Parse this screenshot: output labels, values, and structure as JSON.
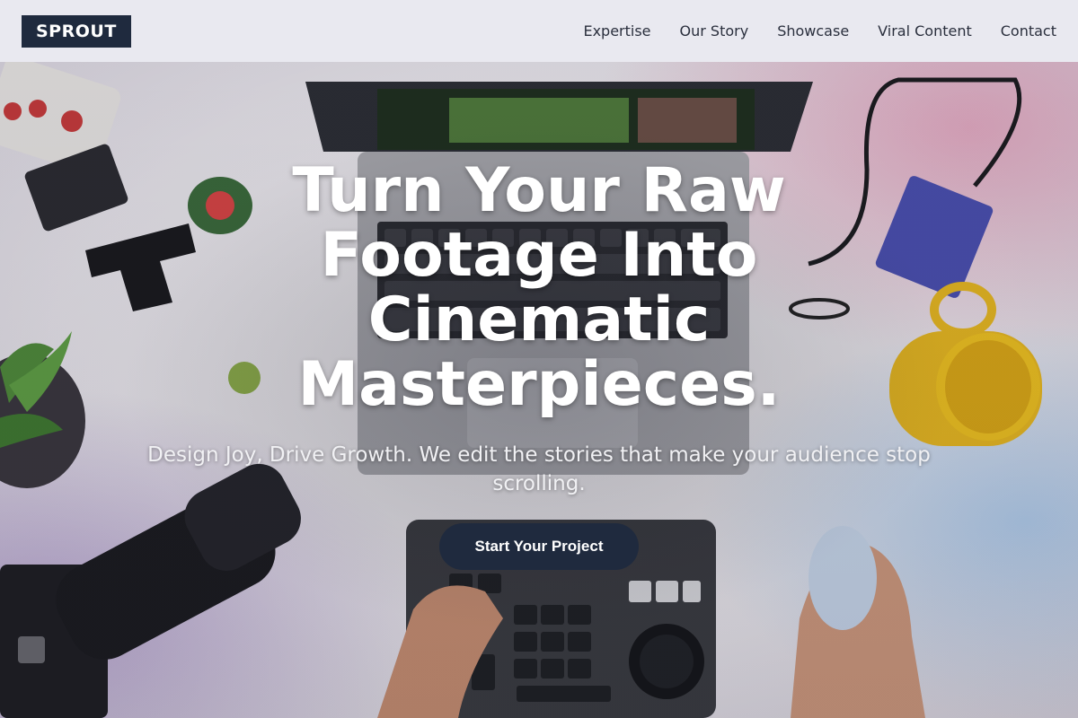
{
  "brand": {
    "logo_text": "SPROUT"
  },
  "nav": {
    "items": [
      {
        "label": "Expertise"
      },
      {
        "label": "Our Story"
      },
      {
        "label": "Showcase"
      },
      {
        "label": "Viral Content"
      },
      {
        "label": "Contact"
      }
    ]
  },
  "hero": {
    "headline": "Turn Your Raw Footage Into Cinematic Masterpieces.",
    "subheadline": "Design Joy, Drive Growth. We edit the stories that make your audience stop scrolling.",
    "cta_label": "Start Your Project"
  },
  "colors": {
    "brand_dark": "#1f2a3e",
    "header_bg": "#eaeaf0",
    "nav_text": "#2a2f3d",
    "hero_text": "#ffffff",
    "mug_yellow": "#e8b820",
    "ssd_blue": "#4a4fb0"
  },
  "background_scene": {
    "objects": [
      "laptop-image",
      "keyboard-image",
      "camera-image",
      "mug-image",
      "ssd-drive-image",
      "mouse-image",
      "editing-console-image",
      "plant-image",
      "toy-figure-image",
      "letter-t-block-image",
      "gamepad-image"
    ]
  }
}
